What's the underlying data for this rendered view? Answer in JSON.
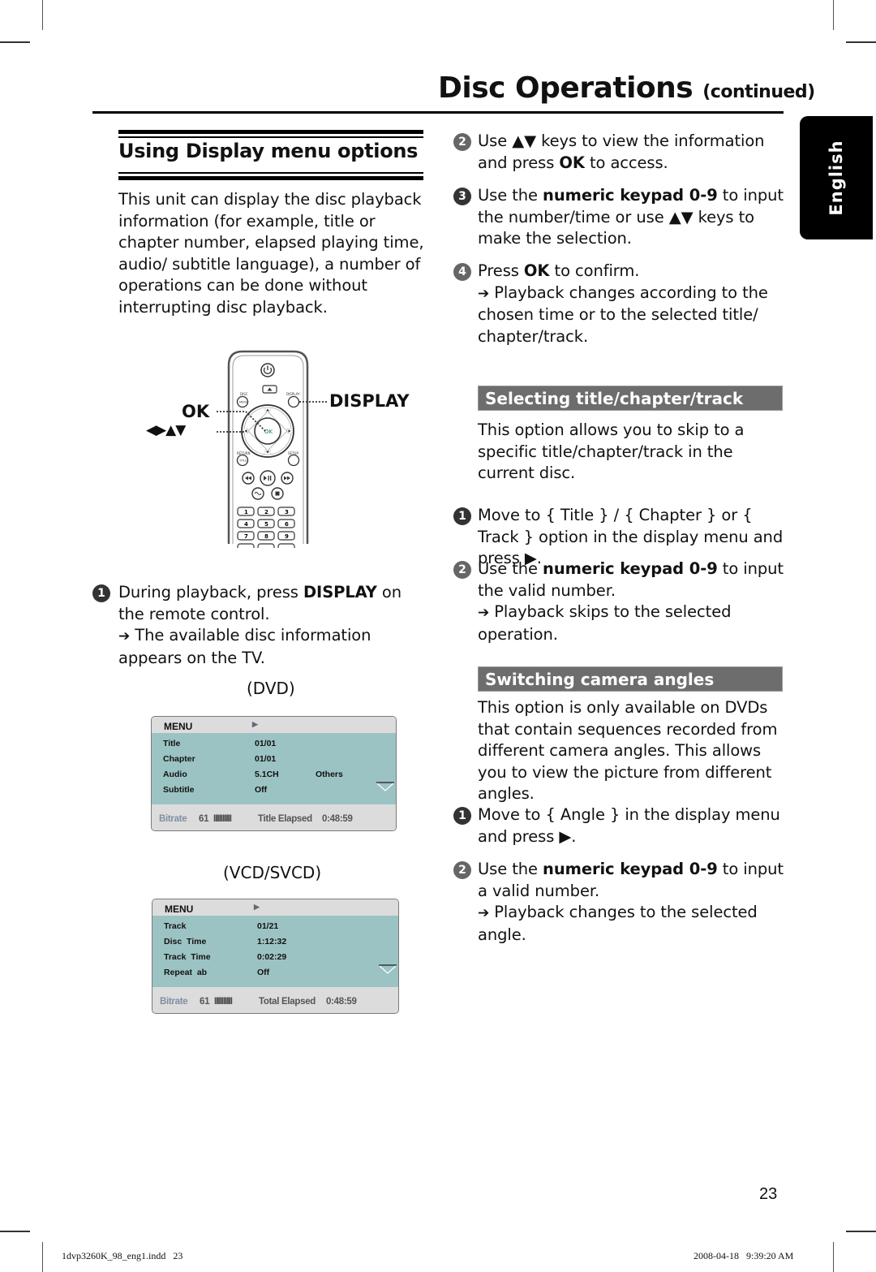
{
  "header": {
    "title": "Disc Operations",
    "title_suffix": "(continued)",
    "language_tab": "English"
  },
  "left_column": {
    "section_title": "Using Display menu options",
    "intro": "This unit can display the disc playback information (for example, title or chapter number, elapsed playing time, audio/ subtitle language), a number of operations can be done without interrupting disc playback.",
    "remote": {
      "label_ok": "OK",
      "label_arrows": "◀▶▲▼",
      "label_display": "DISPLAY",
      "btn_disc": "DISC",
      "btn_menu": "MENU",
      "btn_display": "DISPLAY",
      "btn_return": "RETURN",
      "btn_title": "TITLE",
      "btn_setup": "SETUP",
      "btn_ok": "OK",
      "keys": [
        "1",
        "2",
        "3",
        "4",
        "5",
        "6",
        "7",
        "8",
        "9"
      ]
    },
    "step1": {
      "num": "1",
      "pre": "During playback, press ",
      "bold": "DISPLAY",
      "post": " on the remote control.",
      "result": "The available disc information appears on the TV."
    },
    "dvd_caption": "(DVD)",
    "dvd_osd": {
      "menu": "MENU",
      "rows": [
        {
          "label": "Title",
          "value": "01/01",
          "extra": ""
        },
        {
          "label": "Chapter",
          "value": "01/01",
          "extra": ""
        },
        {
          "label": "Audio",
          "value": "5.1CH",
          "extra": "Others"
        },
        {
          "label": "Subtitle",
          "value": "Off",
          "extra": ""
        }
      ],
      "bitrate_label": "Bitrate",
      "bitrate_value": "61",
      "bitrate_bars": "IIIIIIIIII",
      "elapsed_label": "Title Elapsed",
      "elapsed_value": "0:48:59"
    },
    "vcd_caption": "(VCD/SVCD)",
    "vcd_osd": {
      "menu": "MENU",
      "rows": [
        {
          "label": "Track",
          "value": "01/21",
          "extra": ""
        },
        {
          "label": "Disc  Time",
          "value": "1:12:32",
          "extra": ""
        },
        {
          "label": "Track  Time",
          "value": "0:02:29",
          "extra": ""
        },
        {
          "label": "Repeat  ab",
          "value": "Off",
          "extra": ""
        }
      ],
      "bitrate_label": "Bitrate",
      "bitrate_value": "61",
      "bitrate_bars": "IIIIIIIIII",
      "elapsed_label": "Total Elapsed",
      "elapsed_value": "0:48:59"
    }
  },
  "right_column": {
    "step2": {
      "num": "2",
      "pre": "Use ▲▼ keys to view the information and press ",
      "bold": "OK",
      "post": " to access."
    },
    "step3": {
      "num": "3",
      "pre": "Use the ",
      "bold": "numeric keypad 0-9",
      "post": " to input the number/time or use ▲▼ keys to make the selection."
    },
    "step4": {
      "num": "4",
      "pre": "Press ",
      "bold": "OK",
      "post": " to confirm.",
      "result": "Playback changes according to the chosen time or to the selected title/ chapter/track."
    },
    "section_title_select": "Selecting title/chapter/track",
    "select_intro": "This option allows you to skip to a specific title/chapter/track in the current disc.",
    "select_step1": {
      "num": "1",
      "text": "Move to { Title } / { Chapter } or { Track } option in the display menu and press ▶."
    },
    "select_step2": {
      "num": "2",
      "pre": "Use the ",
      "bold": "numeric keypad 0-9",
      "post": " to input the valid number.",
      "result": "Playback skips to the selected operation."
    },
    "section_title_angle": "Switching camera angles",
    "angle_intro": "This option is only available on DVDs that contain sequences recorded from different camera angles. This allows you to view the picture from different angles.",
    "angle_step1": {
      "num": "1",
      "text": "Move to { Angle } in the display menu and press ▶."
    },
    "angle_step2": {
      "num": "2",
      "pre": "Use the ",
      "bold": "numeric keypad 0-9",
      "post": " to input a valid number.",
      "result": "Playback changes to the selected angle."
    }
  },
  "footer": {
    "page_number": "23",
    "file_info": "1dvp3260K_98_eng1.indd   23",
    "timestamp": "2008-04-18   9:39:20 AM"
  },
  "symbols": {
    "result_arrow": "➔",
    "play_arrow": "▶"
  }
}
